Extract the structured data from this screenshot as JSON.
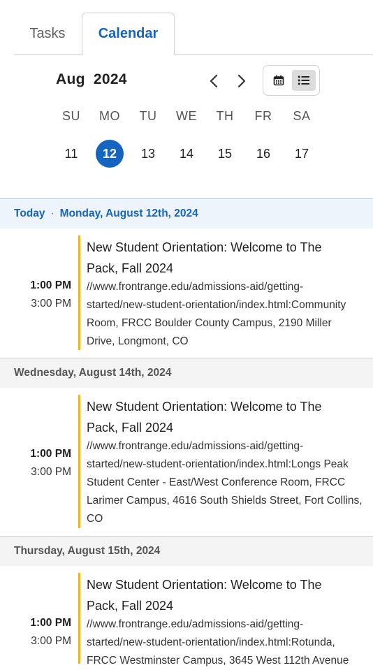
{
  "tabs": [
    {
      "label": "Tasks"
    },
    {
      "label": "Calendar",
      "active": true
    }
  ],
  "calendar": {
    "month_label": "Aug 2024",
    "weekdays": [
      "SU",
      "MO",
      "TU",
      "WE",
      "TH",
      "FR",
      "SA"
    ],
    "days": [
      "11",
      "12",
      "13",
      "14",
      "15",
      "16",
      "17"
    ],
    "selected_day": "12"
  },
  "agenda": [
    {
      "today_label": "Today",
      "date_label": "Monday, August 12th, 2024",
      "event": {
        "start": "1:00 PM",
        "end": "3:00 PM",
        "title": "New Student Orientation: Welcome to The Pack, Fall 2024",
        "location": "//www.frontrange.edu/admissions-aid/getting-started/new-student-orientation/index.html:Community Room, FRCC Boulder County Campus, 2190 Miller Drive, Longmont, CO"
      }
    },
    {
      "date_label": "Wednesday, August 14th, 2024",
      "event": {
        "start": "1:00 PM",
        "end": "3:00 PM",
        "title": "New Student Orientation: Welcome to The Pack, Fall 2024",
        "location": "//www.frontrange.edu/admissions-aid/getting-started/new-student-orientation/index.html:Longs Peak Student Center - East/West Conference Room, FRCC Larimer Campus, 4616 South Shields Street, Fort Collins, CO"
      }
    },
    {
      "date_label": "Thursday, August 15th, 2024",
      "event": {
        "start": "1:00 PM",
        "end": "3:00 PM",
        "title": "New Student Orientation: Welcome to The Pack, Fall 2024",
        "location": "//www.frontrange.edu/admissions-aid/getting-started/new-student-orientation/index.html:Rotunda, FRCC Westminster Campus, 3645 West 112th Avenue"
      }
    }
  ],
  "icons": {
    "prev": "chevron-left-icon",
    "next": "chevron-right-icon",
    "month_view": "calendar-icon",
    "list_view": "list-icon"
  },
  "colors": {
    "accent": "#1565c0",
    "event_bar": "#f0b323",
    "today_bg": "#eef4fb"
  }
}
